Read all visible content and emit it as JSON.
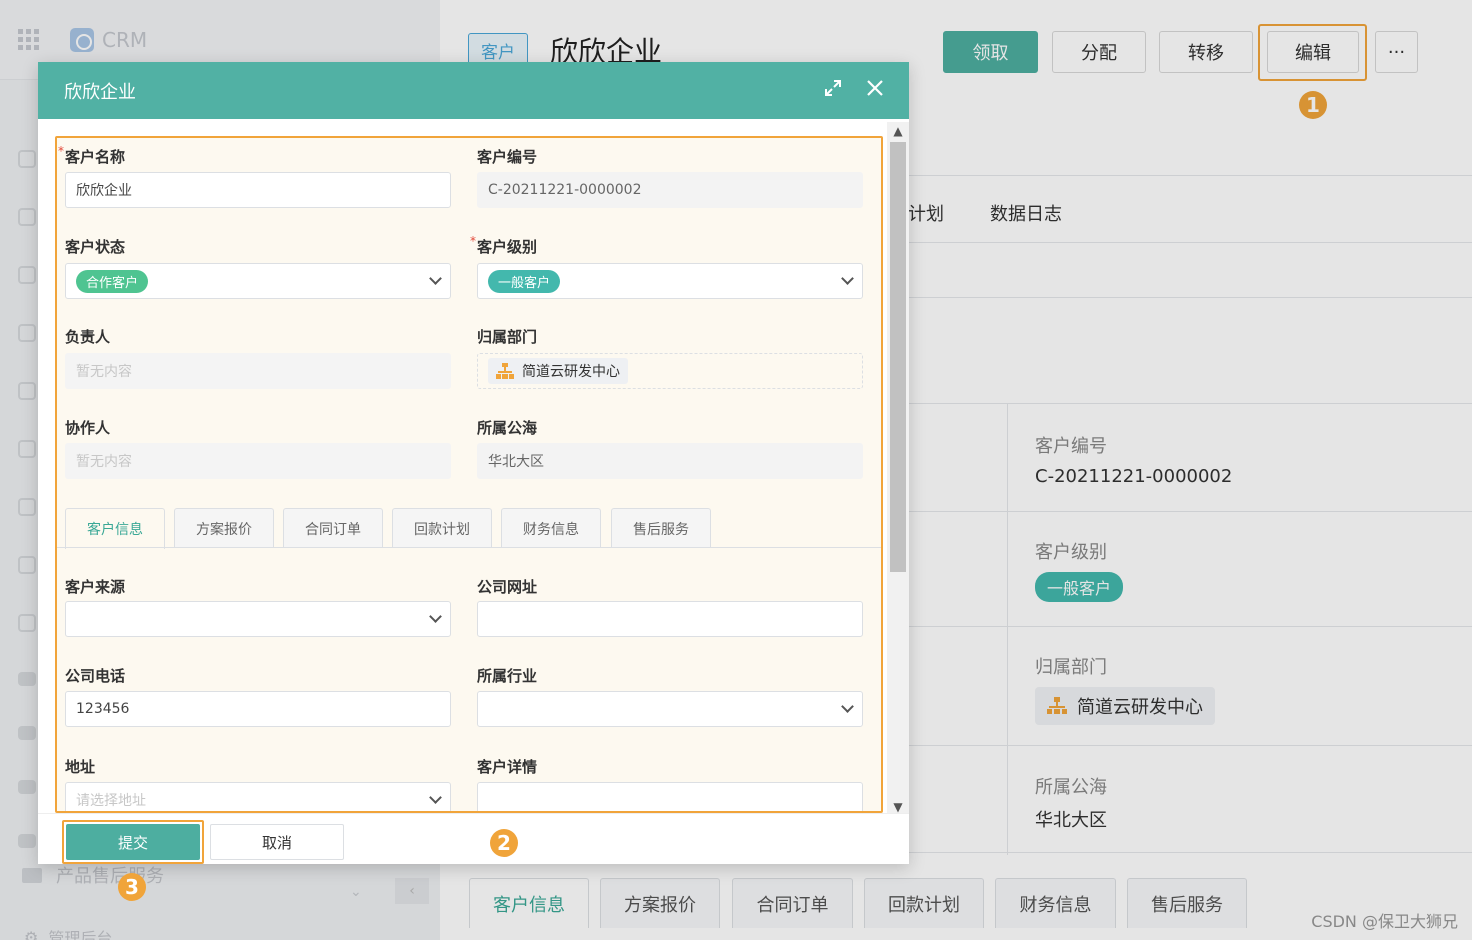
{
  "sidebar": {
    "brand": "CRM",
    "product_item": "产品售后服务",
    "admin_item": "管理后台",
    "collapse_glyph": "‹"
  },
  "record": {
    "type_tag": "客户",
    "title": "欣欣企业",
    "actions": {
      "claim": "领取",
      "assign": "分配",
      "transfer": "转移",
      "edit": "编辑",
      "more": "···"
    },
    "tabs": [
      "计划",
      "数据日志"
    ],
    "fields": {
      "code_label": "客户编号",
      "code_value": "C-20211221-0000002",
      "level_label": "客户级别",
      "level_value": "一般客户",
      "dept_label": "归属部门",
      "dept_value": "简道云研发中心",
      "sea_label": "所属公海",
      "sea_value": "华北大区"
    },
    "bottom_tabs": [
      "客户信息",
      "方案报价",
      "合同订单",
      "回款计划",
      "财务信息",
      "售后服务"
    ]
  },
  "modal": {
    "title": "欣欣企业",
    "fields": {
      "name_label": "客户名称",
      "name_value": "欣欣企业",
      "code_label": "客户编号",
      "code_value": "C-20211221-0000002",
      "status_label": "客户状态",
      "status_value": "合作客户",
      "level_label": "客户级别",
      "level_value": "一般客户",
      "owner_label": "负责人",
      "owner_placeholder": "暂无内容",
      "dept_label": "归属部门",
      "dept_value": "简道云研发中心",
      "collab_label": "协作人",
      "collab_placeholder": "暂无内容",
      "sea_label": "所属公海",
      "sea_value": "华北大区",
      "source_label": "客户来源",
      "website_label": "公司网址",
      "phone_label": "公司电话",
      "phone_value": "123456",
      "industry_label": "所属行业",
      "address_label": "地址",
      "address_placeholder": "请选择地址",
      "detail_label": "客户详情"
    },
    "tabs": [
      "客户信息",
      "方案报价",
      "合同订单",
      "回款计划",
      "财务信息",
      "售后服务"
    ],
    "submit": "提交",
    "cancel": "取消"
  },
  "callouts": [
    "1",
    "2",
    "3"
  ],
  "watermark": "CSDN @保卫大狮兄",
  "colors": {
    "primary": "#4daea0",
    "highlight": "#f1a43a",
    "required": "#e34a3a",
    "status_green": "#4fc491",
    "level_teal": "#43b8ad"
  }
}
